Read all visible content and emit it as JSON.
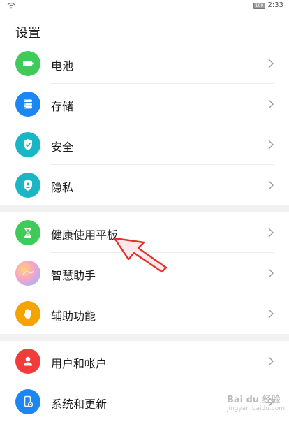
{
  "status_bar": {
    "battery": "100",
    "time": "2:33"
  },
  "page_title": "设置",
  "groups": [
    {
      "items": [
        {
          "label": "电池",
          "icon": "battery-icon",
          "color": "#3ecb5a"
        },
        {
          "label": "存储",
          "icon": "storage-icon",
          "color": "#1c86f2"
        },
        {
          "label": "安全",
          "icon": "shield-check-icon",
          "color": "#19b7c6"
        },
        {
          "label": "隐私",
          "icon": "privacy-shield-icon",
          "color": "#19b7c6"
        }
      ]
    },
    {
      "items": [
        {
          "label": "健康使用平板",
          "icon": "hourglass-icon",
          "color": "#3ecb5a"
        },
        {
          "label": "智慧助手",
          "icon": "assistant-icon",
          "color": "gradient"
        },
        {
          "label": "辅助功能",
          "icon": "hand-icon",
          "color": "#f5a300"
        }
      ]
    },
    {
      "items": [
        {
          "label": "用户和帐户",
          "icon": "user-icon",
          "color": "#f23b3b"
        },
        {
          "label": "系统和更新",
          "icon": "system-update-icon",
          "color": "#1c86f2"
        }
      ]
    }
  ],
  "watermark": {
    "brand": "Bai du 经验",
    "url": "jingyan.baidu.com"
  }
}
